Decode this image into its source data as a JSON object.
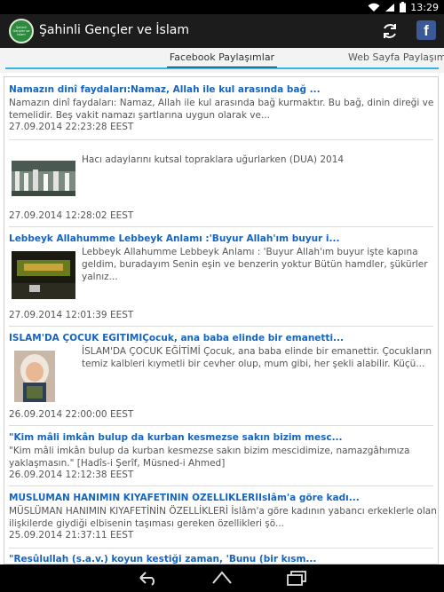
{
  "status": {
    "time": "13:29"
  },
  "app": {
    "title": "Şahinli Gençler ve İslam",
    "logo_text": "Şahinli Gençler ve İslam"
  },
  "tabs": [
    {
      "label": "Facebook Paylaşımlar"
    },
    {
      "label": "Web Sayfa Paylaşımlar"
    }
  ],
  "posts": [
    {
      "title": "Namazın dinî faydaları:Namaz, Allah ile kul arasında bağ ...",
      "body": "Namazın dinî faydaları: Namaz, Allah ile kul arasında bağ kurmaktır. Bu bağ, dinin direği ve temelidir. Beş vakit namazı şartlarına uygun olarak ve...",
      "date": "27.09.2014 22:23:28 EEST"
    },
    {
      "title": "",
      "body": "Hacı adaylarını kutsal topraklara uğurlarken (DUA) 2014",
      "date": "27.09.2014 12:28:02 EEST"
    },
    {
      "title": "Lebbeyk Allahumme Lebbeyk Anlamı :'Buyur Allah'ım buyur i...",
      "body": "Lebbeyk Allahumme Lebbeyk Anlamı : 'Buyur Allah'ım buyur işte kapına geldim, buradayım Senin eşin ve benzerin yoktur Bütün hamdler, şükürler yalnız...",
      "date": "27.09.2014 12:01:39 EEST"
    },
    {
      "title": "İSLAM'DA ÇOCUK EĞİTİMİÇocuk, ana baba elinde bir emanetti...",
      "body": "İSLAM'DA ÇOCUK EĞİTİMİ Çocuk, ana baba elinde bir emanettir. Çocukların temiz kalbleri kıymetli bir cevher olup, mum gibi, her şekli alabilir. Küçü...",
      "date": "26.09.2014 22:00:00 EEST"
    },
    {
      "title": "\"Kim mâli imkân bulup da kurban kesmezse sakın bizim mesc...",
      "body": "\"Kim mâli imkân bulup da kurban kesmezse sakın bizim mescidimize, namazgâhımıza yaklaşmasın.\" [Hadîs-i Şerîf, Müsned-i Ahmed]",
      "date": "26.09.2014 12:12:38 EEST"
    },
    {
      "title": "MÜSLÜMAN HANIMIN KIYAFETİNİN ÖZELLİKLERİİslâm'a göre kadı...",
      "body": "MÜSLÜMAN HANIMIN KIYAFETİNİN ÖZELLİKLERİ İslâm'a göre kadının yabancı erkeklerle olan ilişkilerde giydiği elbisenin taşıması gereken özellikleri şö...",
      "date": "25.09.2014 21:37:11 EEST"
    },
    {
      "title": "\"Resûlullah (s.a.v.) koyun kestiği zaman, 'Bunu (bir kısm...",
      "body": "",
      "date": ""
    }
  ]
}
